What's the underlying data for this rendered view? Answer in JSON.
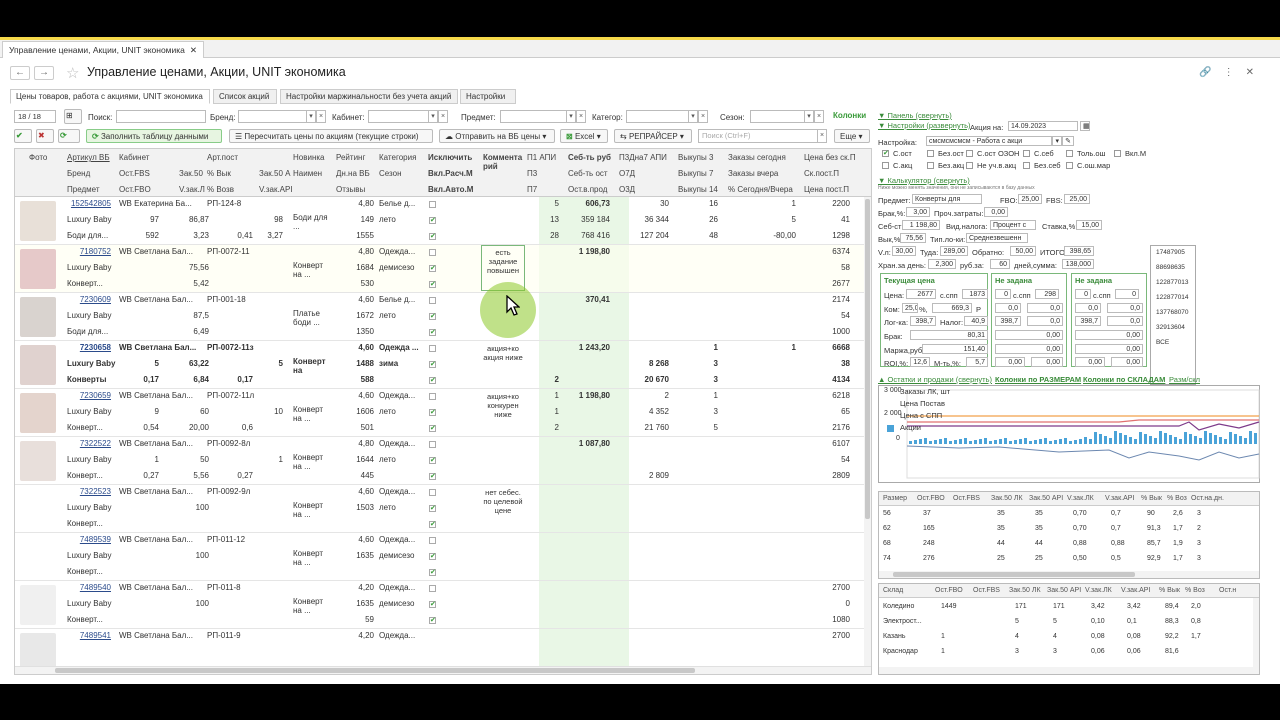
{
  "window_tab": "Управление ценами, Акции, UNIT экономика",
  "page_title": "Управление ценами, Акции, UNIT экономика",
  "form_tabs": [
    "Цены товаров, работа с акциями, UNIT экономика",
    "Список акций",
    "Настройки маржинальности без учета акций",
    "Настройки"
  ],
  "filters": {
    "counter": "18 / 18",
    "search_label": "Поиск:",
    "brand_label": "Бренд:",
    "cabinet_label": "Кабинет:",
    "subject_label": "Предмет:",
    "category_label": "Категор:",
    "season_label": "Сезон:",
    "columns_link": "Колонки"
  },
  "toolbar": {
    "fill": "Заполнить таблицу данными",
    "recalc": "Пересчитать цены по акциям (текущие строки)",
    "send": "Отправить на ВБ цены",
    "excel": "Excel",
    "repricer": "РЕПРАЙСЕР",
    "search_placeholder": "Поиск (Ctrl+F)",
    "more": "Еще"
  },
  "headers": {
    "r1": [
      "Фото",
      "Артикул ВБ",
      "Кабинет",
      "Арт.пост",
      "Новинка",
      "Рейтинг",
      "Категория",
      "Исключить",
      "Коммента рий",
      "П1 АПИ",
      "Себ-ть руб",
      "П3Дна7 АПИ",
      "Выкупы 3",
      "Заказы сегодня",
      "Цена без ск.П"
    ],
    "r2": [
      "Бренд",
      "Ост.FBS",
      "Зак.50 ЛК",
      "% Вык",
      "Зак.50 API",
      "Наимен",
      "Дн.на ВБ",
      "Сезон",
      "Вкл.Расч.М",
      "П3",
      "Себ-ть ост",
      "О7Д",
      "Выкупы 7",
      "Заказы вчера",
      "Ск.пост.П"
    ],
    "r3": [
      "Предмет",
      "Ост.FBO",
      "V.зак.ЛК",
      "% Возв",
      "V.зак.API",
      "Отзывы",
      "Вкл.Авто.М",
      "П7",
      "Ост.в.прод",
      "О3Д",
      "Выкупы 14",
      "% Сегодня/Вчера",
      "Цена пост.П"
    ]
  },
  "rows": [
    {
      "art": "152542805",
      "cab": "WB Екатерина Ба...",
      "artpost": "РП-124-8",
      "rating": "4,80",
      "cat": "Белье д...",
      "p1": "5",
      "seb": "606,73",
      "p3d": "30",
      "vyk3": "16",
      "zak_today": "1",
      "price": "2200",
      "brand": "Luxury Baby",
      "fbs": "97",
      "zak50lk": "86,87",
      "pvyk": "98",
      "name": "Боди для ...",
      "dni": "149",
      "season": "лето",
      "p3": "13",
      "sebost": "359 184",
      "o7d": "36 344",
      "vyk7": "26",
      "zak_yest": "5",
      "sk": "41",
      "subject": "Боди для...",
      "fbo": "592",
      "vzaklk": "3,23",
      "pvozv": "0,41",
      "vzakapi": "3,27",
      "otz": "1555",
      "p7": "28",
      "ost": "768 416",
      "o3d": "127 204",
      "vyk14": "48",
      "pct": "-80,00",
      "cp": "1298",
      "thumb": "#e8e0d8"
    },
    {
      "art": "7180752",
      "cab": "WB Светлана Бал...",
      "artpost": "РП-0072-11",
      "rating": "4,80",
      "cat": "Одежда...",
      "p1": "",
      "seb": "1 198,80",
      "p3d": "",
      "vyk3": "",
      "zak_today": "",
      "price": "6374",
      "brand": "Luxury Baby",
      "fbs": "",
      "zak50lk": "75,56",
      "pvyk": "",
      "name": "Конверт на ...",
      "dni": "1684",
      "season": "демисезо",
      "p3": "",
      "sebost": "",
      "o7d": "",
      "vyk7": "",
      "zak_yest": "",
      "sk": "58",
      "subject": "Конверт...",
      "fbo": "",
      "vzaklk": "5,42",
      "pvozv": "",
      "vzakapi": "",
      "otz": "530",
      "p7": "",
      "ost": "",
      "o3d": "",
      "vyk14": "",
      "pct": "",
      "cp": "2677",
      "comment": "есть задание повышен",
      "thumb": "#e6c9c9"
    },
    {
      "art": "7230609",
      "cab": "WB Светлана Бал...",
      "artpost": "РП-001-18",
      "rating": "4,60",
      "cat": "Белье д...",
      "p1": "",
      "seb": "370,41",
      "p3d": "",
      "vyk3": "",
      "zak_today": "",
      "price": "2174",
      "brand": "Luxury Baby",
      "fbs": "",
      "zak50lk": "87,5",
      "pvyk": "",
      "name": "Платье боди ...",
      "dni": "1672",
      "season": "лето",
      "p3": "",
      "sebost": "",
      "o7d": "",
      "vyk7": "",
      "zak_yest": "",
      "sk": "54",
      "subject": "Боди для...",
      "fbo": "",
      "vzaklk": "6,49",
      "pvozv": "",
      "vzakapi": "",
      "otz": "1350",
      "p7": "",
      "ost": "",
      "o3d": "",
      "vyk14": "",
      "pct": "",
      "cp": "1000",
      "thumb": "#d9d3cf"
    },
    {
      "art": "7230658",
      "cab": "WB Светлана Бал...",
      "artpost": "РП-0072-11з",
      "rating": "4,60",
      "cat": "Одежда ...",
      "p1": "",
      "seb": "1 243,20",
      "p3d": "",
      "vyk3": "1",
      "zak_today": "1",
      "price": "6668",
      "brand": "Luxury Baby",
      "fbs": "5",
      "zak50lk": "63,22",
      "pvyk": "5",
      "name": "Конверт на выписку",
      "dni": "1488",
      "season": "зима",
      "p3": "",
      "sebost": "",
      "o7d": "8 268",
      "vyk7": "3",
      "zak_yest": "",
      "sk": "38",
      "subject": "Конверты",
      "fbo": "0,17",
      "vzaklk": "6,84",
      "pvozv": "0,17",
      "vzakapi": "",
      "otz": "588",
      "p7": "2",
      "ost": "",
      "o3d": "20 670",
      "vyk14": "3",
      "pct": "",
      "cp": "4134",
      "comment": "акция+ко акция ниже",
      "bold": true,
      "thumb": "#e0d2cf"
    },
    {
      "art": "7230659",
      "cab": "WB Светлана Бал...",
      "artpost": "РП-0072-11л",
      "rating": "4,60",
      "cat": "Одежда...",
      "p1": "1",
      "seb": "1 198,80",
      "p3d": "2",
      "vyk3": "1",
      "zak_today": "",
      "price": "6218",
      "brand": "Luxury Baby",
      "fbs": "9",
      "zak50lk": "60",
      "pvyk": "10",
      "name": "Конверт на ...",
      "dni": "1606",
      "season": "лето",
      "p3": "1",
      "sebost": "",
      "o7d": "4 352",
      "vyk7": "3",
      "zak_yest": "",
      "sk": "65",
      "subject": "Конверт...",
      "fbo": "0,54",
      "vzaklk": "20,00",
      "pvozv": "0,6",
      "vzakapi": "",
      "otz": "501",
      "p7": "2",
      "ost": "",
      "o3d": "21 760",
      "vyk14": "5",
      "pct": "",
      "cp": "2176",
      "comment": "акция+ко конкурен ниже",
      "thumb": "#e4d4cd"
    },
    {
      "art": "7322522",
      "cab": "WB Светлана Бал...",
      "artpost": "РП-0092-8л",
      "rating": "4,80",
      "cat": "Одежда...",
      "p1": "",
      "seb": "1 087,80",
      "p3d": "",
      "vyk3": "",
      "zak_today": "",
      "price": "6107",
      "brand": "Luxury Baby",
      "fbs": "1",
      "zak50lk": "50",
      "pvyk": "1",
      "name": "Конверт на ...",
      "dni": "1644",
      "season": "лето",
      "p3": "",
      "sebost": "",
      "o7d": "",
      "vyk7": "",
      "zak_yest": "",
      "sk": "54",
      "subject": "Конверт...",
      "fbo": "0,27",
      "vzaklk": "5,56",
      "pvozv": "0,27",
      "vzakapi": "",
      "otz": "445",
      "p7": "",
      "ost": "",
      "o3d": "2 809",
      "vyk14": "",
      "pct": "",
      "cp": "2809",
      "thumb": "#e8dfdb"
    },
    {
      "art": "7322523",
      "cab": "WB Светлана Бал...",
      "artpost": "РП-0092-9л",
      "rating": "4,60",
      "cat": "Одежда...",
      "p1": "",
      "seb": "",
      "p3d": "",
      "vyk3": "",
      "zak_today": "",
      "price": "",
      "brand": "Luxury Baby",
      "fbs": "",
      "zak50lk": "100",
      "pvyk": "",
      "name": "Конверт на ...",
      "dni": "1503",
      "season": "лето",
      "p3": "",
      "sebost": "",
      "o7d": "",
      "vyk7": "",
      "zak_yest": "",
      "sk": "",
      "subject": "Конверт...",
      "fbo": "",
      "vzaklk": "",
      "pvozv": "",
      "vzakapi": "",
      "otz": "",
      "p7": "",
      "ost": "",
      "o3d": "",
      "vyk14": "",
      "pct": "",
      "cp": "",
      "comment": "нет себес. по целевой цене",
      "thumb": ""
    },
    {
      "art": "7489539",
      "cab": "WB Светлана Бал...",
      "artpost": "РП-011-12",
      "rating": "4,60",
      "cat": "Одежда...",
      "p1": "",
      "seb": "",
      "p3d": "",
      "vyk3": "",
      "zak_today": "",
      "price": "",
      "brand": "Luxury Baby",
      "fbs": "",
      "zak50lk": "100",
      "pvyk": "",
      "name": "Конверт на ...",
      "dni": "1635",
      "season": "демисезо",
      "p3": "",
      "sebost": "",
      "o7d": "",
      "vyk7": "",
      "zak_yest": "",
      "sk": "",
      "subject": "Конверт...",
      "fbo": "",
      "vzaklk": "",
      "pvozv": "",
      "vzakapi": "",
      "otz": "",
      "p7": "",
      "ost": "",
      "o3d": "",
      "vyk14": "",
      "pct": "",
      "cp": "",
      "thumb": ""
    },
    {
      "art": "7489540",
      "cab": "WB Светлана Бал...",
      "artpost": "РП-011-8",
      "rating": "4,20",
      "cat": "Одежда...",
      "p1": "",
      "seb": "",
      "p3d": "",
      "vyk3": "",
      "zak_today": "",
      "price": "2700",
      "brand": "Luxury Baby",
      "fbs": "",
      "zak50lk": "100",
      "pvyk": "",
      "name": "Конверт на ...",
      "dni": "1635",
      "season": "демисезо",
      "p3": "",
      "sebost": "",
      "o7d": "",
      "vyk7": "",
      "zak_yest": "",
      "sk": "0",
      "subject": "Конверт...",
      "fbo": "",
      "vzaklk": "",
      "pvozv": "",
      "vzakapi": "",
      "otz": "59",
      "p7": "",
      "ost": "",
      "o3d": "",
      "vyk14": "",
      "pct": "",
      "cp": "1080",
      "thumb": "#f0f0f0"
    },
    {
      "art": "7489541",
      "cab": "WB Светлана Бал...",
      "artpost": "РП-011-9",
      "rating": "4,20",
      "cat": "Одежда...",
      "price": "2700",
      "thumb": "#e8e8e8"
    }
  ],
  "right": {
    "panel_link": "▼ Панель (свернуть)",
    "settings_link": "▼ Настройки (развернуть)",
    "promo_label": "Акция на:",
    "promo_date": "14.09.2023 17:56:19",
    "setting_label": "Настройка:",
    "setting_value": "смсмсмсмсм - Работа с акци",
    "checks": [
      "С.ост",
      "Без.ост",
      "С.ост ОЗОН",
      "С.себ",
      "Толь.ош",
      "Вкл.М",
      "С.акц",
      "Без.акц",
      "Не уч.в.акц",
      "Без.себ",
      "С.ош.мар"
    ],
    "calc_link": "▼ Калькулятор (свернуть)",
    "calc_hint": "Ниже можно менять значения, они не записываются в базу данных",
    "subject_l": "Предмет:",
    "subject_v": "Конверты для малыш",
    "fbo_l": "FBO:",
    "fbo_v": "25,00",
    "fbs_l": "FBS:",
    "fbs_v": "25,00",
    "brak_l": "Брак,%:",
    "brak_v": "3,00",
    "proch_l": "Проч.затраты:",
    "proch_v": "0,00",
    "seb_l": "Себ-сть:",
    "seb_v": "1 198,80",
    "vid_l": "Вид.налога:",
    "vid_v": "Процент с",
    "stavka_l": "Ставка,%:",
    "stavka_v": "15,00",
    "vyk_l": "Вык,%:",
    "vyk_v": "75,56",
    "tip_l": "Тип.ло-ки:",
    "tip_v": "Среднезвешенн",
    "vl_l": "V.л:",
    "vl_v": "30,00",
    "tuda_l": "Туда:",
    "tuda_v": "289,00",
    "obr_l": "Обратно:",
    "obr_v": "50,00",
    "itogo_l": "ИТОГО:",
    "itogo_v": "398,65",
    "hran_l": "Хран.за день:",
    "hran_v": "2,300",
    "rub_l": "руб.за:",
    "rub_v": "60",
    "dney_l": "дней,сумма:",
    "dney_v": "138,000",
    "ids": [
      "17487905",
      "88698635",
      "122877013",
      "122877014",
      "137768070",
      "32913604",
      "ВСЕ"
    ],
    "cur_title": "Текущая цена",
    "cur": {
      "price_l": "Цена:",
      "price": "2677",
      "spp_l": "с.спп",
      "spp": "1873",
      "kom_l": "Ком:",
      "kom": "25,0",
      "pct": "%,",
      "kom2": "669,3",
      "r": "Р",
      "log_l": "Лог-ка:",
      "log": "398,7",
      "nal_l": "Налог:",
      "nal": "40,9",
      "brak_l": "Брак:",
      "brak": "80,31",
      "marzha_l": "Маржа,руб:",
      "marzha": "151,40",
      "roi_l": "ROI,%:",
      "roi": "12,6",
      "mt_l": "М-ть,%:",
      "mt": "5,7"
    },
    "n1_title": "Не задана",
    "n1": {
      "p": "0",
      "spp": "298",
      "a": "0,0",
      "b": "0,0",
      "c": "398,7",
      "d": "0,0",
      "e": "0,00",
      "f": "0,00",
      "g": "0,00",
      "h": "0,00"
    },
    "n2_title": "Не задана",
    "n2": {
      "p": "0",
      "spp": "0",
      "a": "0,0",
      "b": "0,0",
      "c": "398,7",
      "d": "0,0",
      "e": "0,00",
      "f": "0,00",
      "g": "0,00",
      "h": "0,00"
    },
    "stock_link": "▲ Остатки и продажи (свернуть)",
    "by_size": "Колонки по РАЗМЕРАМ",
    "by_wh": "Колонки по СКЛАДАМ",
    "razm": "Разм/скл",
    "legend": [
      "Заказы ЛК, шт",
      "Цена Постав",
      "Цена с СПП",
      "Акции"
    ],
    "y_ticks": [
      "3 000",
      "2 000",
      "0"
    ],
    "size_headers": [
      "Размер",
      "Ост.FBO",
      "Ост.FBS",
      "Зак.50 ЛК",
      "Зак.50 API",
      "V.зак.ЛК",
      "V.зак.API",
      "% Вык",
      "% Воз",
      "Ост.на.дн."
    ],
    "sizes": [
      [
        "56",
        "37",
        "",
        "35",
        "35",
        "0,70",
        "0,7",
        "90",
        "2,6",
        "3"
      ],
      [
        "62",
        "165",
        "",
        "35",
        "35",
        "0,70",
        "0,7",
        "91,3",
        "1,7",
        "2"
      ],
      [
        "68",
        "248",
        "",
        "44",
        "44",
        "0,88",
        "0,88",
        "85,7",
        "1,9",
        "3"
      ],
      [
        "74",
        "276",
        "",
        "25",
        "25",
        "0,50",
        "0,5",
        "92,9",
        "1,7",
        "3"
      ]
    ],
    "wh_headers": [
      "Склад",
      "Ост.FBO",
      "Ост.FBS",
      "Зак.50 ЛК",
      "Зак.50 API",
      "V.зак.ЛК",
      "V.зак.API",
      "% Вык",
      "% Воз",
      "Ост.н"
    ],
    "wh": [
      [
        "Коледино",
        "1449",
        "",
        "171",
        "171",
        "3,42",
        "3,42",
        "89,4",
        "2,0",
        ""
      ],
      [
        "Электрост...",
        "",
        "",
        "5",
        "5",
        "0,10",
        "0,1",
        "88,3",
        "0,8",
        ""
      ],
      [
        "Казань",
        "1",
        "",
        "4",
        "4",
        "0,08",
        "0,08",
        "92,2",
        "1,7",
        ""
      ],
      [
        "Краснодар",
        "1",
        "",
        "3",
        "3",
        "0,06",
        "0,06",
        "81,6",
        "",
        ""
      ]
    ]
  },
  "colors": {
    "accent_green": "#3a9b3a",
    "highlight": "#8cc828",
    "yellow_bar": "#f6d94a"
  }
}
